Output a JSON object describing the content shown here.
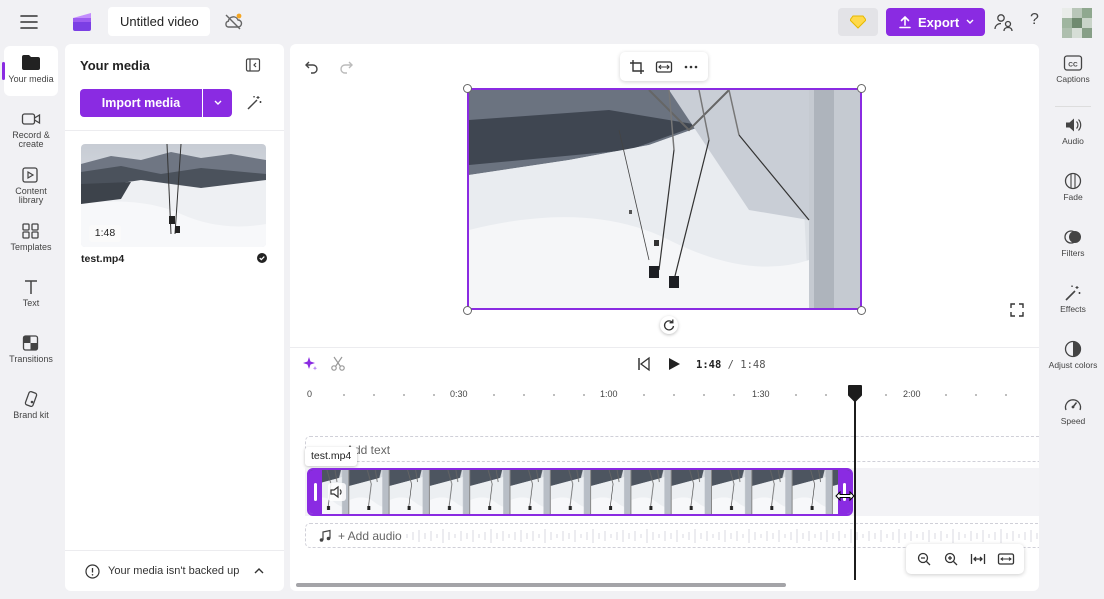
{
  "app": {
    "project_title": "Untitled video",
    "export_label": "Export"
  },
  "left_nav": [
    {
      "label": "Your media",
      "icon": "folder-icon",
      "active": true
    },
    {
      "label": "Record & create",
      "icon": "camera-icon"
    },
    {
      "label": "Content library",
      "icon": "content-library-icon"
    },
    {
      "label": "Templates",
      "icon": "templates-icon"
    },
    {
      "label": "Text",
      "icon": "text-icon"
    },
    {
      "label": "Transitions",
      "icon": "transitions-icon"
    },
    {
      "label": "Brand kit",
      "icon": "brand-kit-icon"
    }
  ],
  "media_panel": {
    "title": "Your media",
    "import_label": "Import media",
    "items": [
      {
        "name": "test.mp4",
        "duration": "1:48"
      }
    ],
    "backup_notice": "Your media isn't backed up"
  },
  "player": {
    "current_time": "1:48",
    "total_time": "/ 1:48"
  },
  "ruler": {
    "labels": [
      "0",
      "0:30",
      "1:00",
      "1:30",
      "2:00"
    ]
  },
  "timeline": {
    "add_text_label": "Add text",
    "add_audio_label": "+ Add audio",
    "clip_name": "test.mp4"
  },
  "right_nav": [
    {
      "label": "Captions",
      "icon": "captions-icon"
    },
    {
      "label": "Audio",
      "icon": "speaker-icon"
    },
    {
      "label": "Fade",
      "icon": "fade-icon"
    },
    {
      "label": "Filters",
      "icon": "filters-icon"
    },
    {
      "label": "Effects",
      "icon": "magic-wand-icon"
    },
    {
      "label": "Adjust colors",
      "icon": "adjust-colors-icon"
    },
    {
      "label": "Speed",
      "icon": "speedometer-icon"
    }
  ],
  "colors": {
    "accent": "#8a2be2",
    "background": "#f1f1f4",
    "panel": "#ffffff"
  }
}
